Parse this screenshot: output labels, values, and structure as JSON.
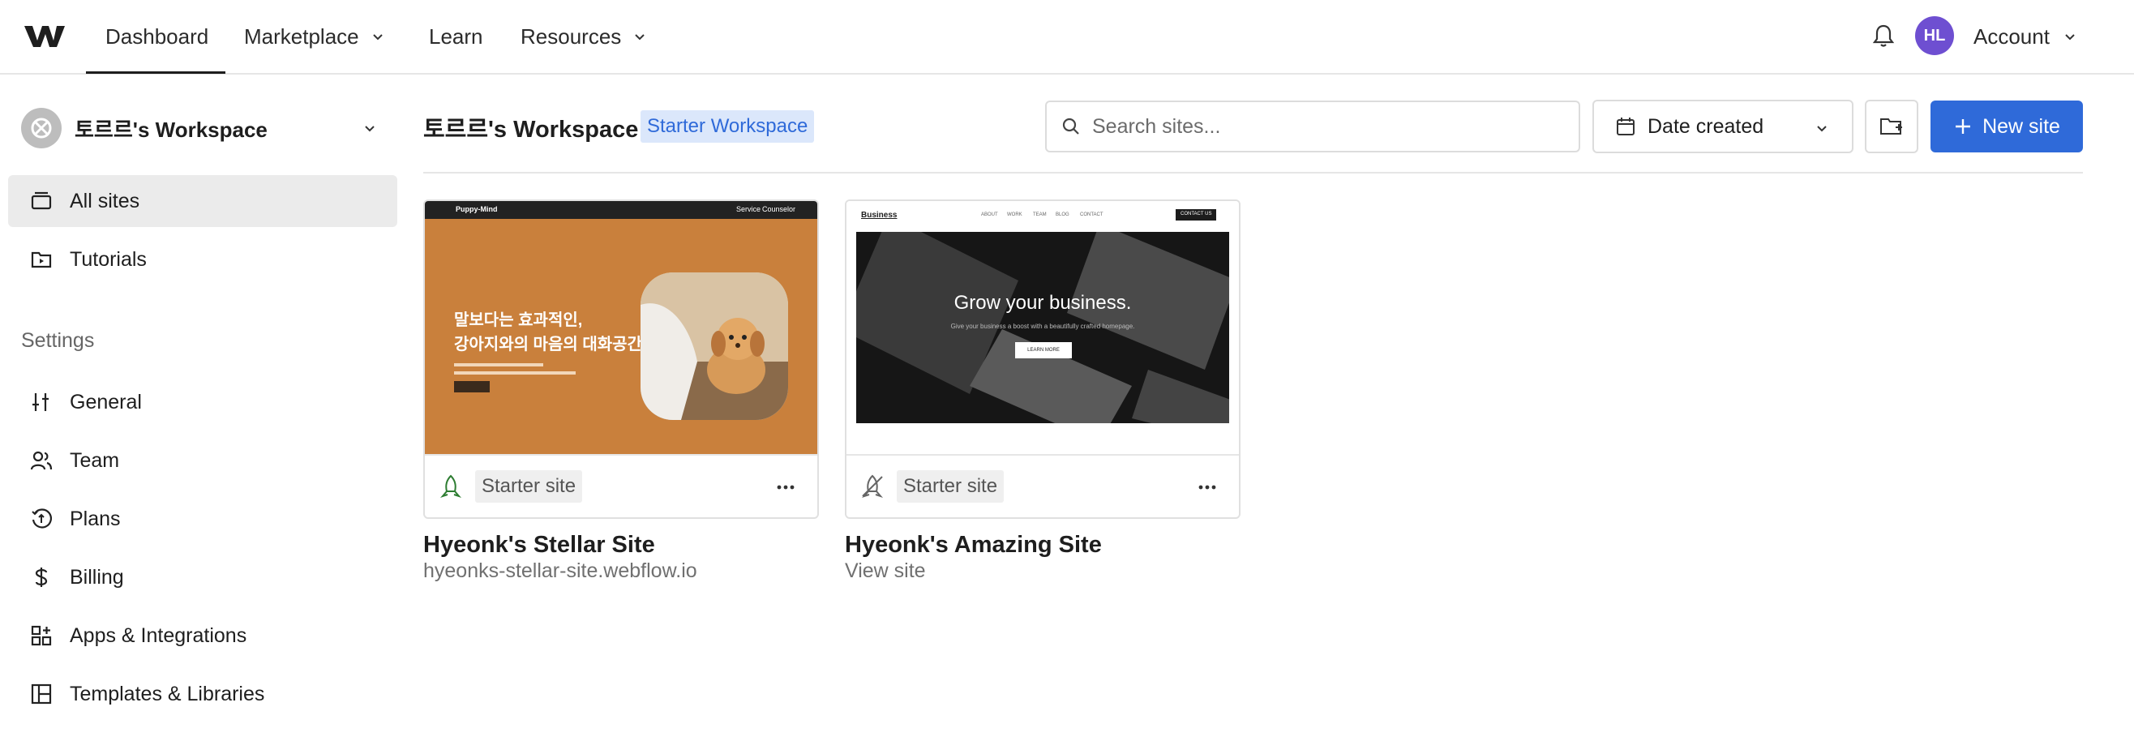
{
  "topnav": {
    "items": [
      {
        "label": "Dashboard"
      },
      {
        "label": "Marketplace"
      },
      {
        "label": "Learn"
      },
      {
        "label": "Resources"
      }
    ],
    "avatar_initials": "HL",
    "account_label": "Account"
  },
  "sidebar": {
    "workspace_name": "토르르's Workspace",
    "items": [
      {
        "label": "All sites",
        "icon": "folder-icon",
        "active": true
      },
      {
        "label": "Tutorials",
        "icon": "tutorials-icon"
      }
    ],
    "settings_heading": "Settings",
    "settings_items": [
      {
        "label": "General",
        "icon": "sliders-icon"
      },
      {
        "label": "Team",
        "icon": "team-icon"
      },
      {
        "label": "Plans",
        "icon": "plans-icon"
      },
      {
        "label": "Billing",
        "icon": "dollar-icon"
      },
      {
        "label": "Apps & Integrations",
        "icon": "apps-icon"
      },
      {
        "label": "Templates & Libraries",
        "icon": "templates-icon"
      }
    ]
  },
  "main": {
    "title": "토르르's Workspace",
    "plan_badge": "Starter Workspace",
    "search_placeholder": "Search sites...",
    "sort_label": "Date created",
    "new_site_label": "New site"
  },
  "sites": [
    {
      "name": "Hyeonk's Stellar Site",
      "subtitle": "hyeonks-stellar-site.webflow.io",
      "tag": "Starter site",
      "published": true,
      "thumb": {
        "brand": "Puppy-Mind",
        "nav": [
          "Service",
          "Counselor"
        ],
        "headline_1": "말보다는 효과적인,",
        "headline_2": "강아지와의 마음의 대화공간"
      }
    },
    {
      "name": "Hyeonk's Amazing Site",
      "subtitle": "View site",
      "tag": "Starter site",
      "published": false,
      "thumb": {
        "brand": "Business",
        "nav": [
          "ABOUT",
          "WORK",
          "TEAM",
          "BLOG",
          "CONTACT"
        ],
        "cta_top": "CONTACT US",
        "headline": "Grow your business.",
        "tagline": "Give your business a boost with a beautifully crafted homepage.",
        "button": "LEARN MORE"
      }
    }
  ],
  "colors": {
    "accent": "#2f6ad9",
    "avatar": "#6e4fd1",
    "badge_bg": "#dbe7fb",
    "published_icon": "#2e7d32"
  }
}
